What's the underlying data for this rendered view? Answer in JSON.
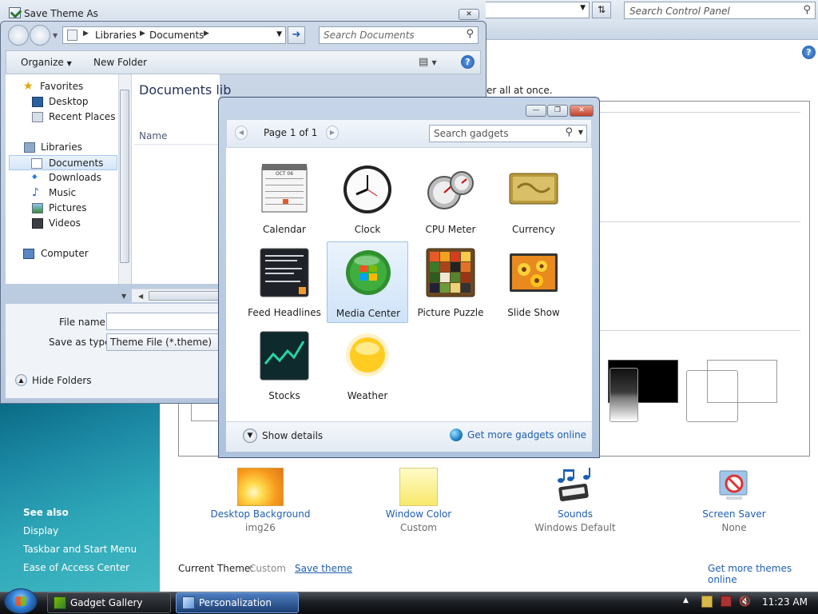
{
  "personalization": {
    "search_placeholder": "Search Control Panel",
    "description_fragment": "er all at once.",
    "sidebar": {
      "see_also": "See also",
      "links": [
        "Display",
        "Taskbar and Start Menu",
        "Ease of Access Center"
      ]
    },
    "settings": [
      {
        "label": "Desktop Background",
        "value": "img26",
        "icon": "desktop-background-thumbnail"
      },
      {
        "label": "Window Color",
        "value": "Custom",
        "icon": "window-color-swatch"
      },
      {
        "label": "Sounds",
        "value": "Windows Default",
        "icon": "sounds-icon"
      },
      {
        "label": "Screen Saver",
        "value": "None",
        "icon": "screen-saver-icon"
      }
    ],
    "current_theme_label": "Current Theme:",
    "current_theme_value": "Custom",
    "save_theme_link": "Save theme",
    "more_themes_link": "Get more themes online",
    "accent_link_color": "#1f5fb4"
  },
  "save_dialog": {
    "title": "Save Theme As",
    "address": {
      "crumbs": [
        "Libraries",
        "Documents"
      ]
    },
    "search_placeholder": "Search Documents",
    "toolbar": {
      "organize": "Organize",
      "new_folder": "New Folder"
    },
    "nav": {
      "favorites": "Favorites",
      "favorite_items": [
        "Desktop",
        "Recent Places"
      ],
      "libraries": "Libraries",
      "library_items": [
        "Documents",
        "Downloads",
        "Music",
        "Pictures",
        "Videos"
      ],
      "computer": "Computer",
      "selected": "Documents"
    },
    "list_title": "Documents lib",
    "column_name": "Name",
    "file_name_label": "File name:",
    "file_name_value": "",
    "save_as_type_label": "Save as type:",
    "save_as_type_value": "Theme File (*.theme)",
    "hide_folders": "Hide Folders"
  },
  "gadget_gallery": {
    "page_label": "Page 1 of 1",
    "search_placeholder": "Search gadgets",
    "gadgets": [
      {
        "name": "Calendar",
        "icon": "calendar-icon",
        "calendar_month": "OCT 06"
      },
      {
        "name": "Clock",
        "icon": "clock-icon"
      },
      {
        "name": "CPU Meter",
        "icon": "cpu-meter-icon"
      },
      {
        "name": "Currency",
        "icon": "currency-icon"
      },
      {
        "name": "Feed Headlines",
        "icon": "feed-headlines-icon"
      },
      {
        "name": "Media Center",
        "icon": "media-center-icon",
        "selected": true
      },
      {
        "name": "Picture Puzzle",
        "icon": "picture-puzzle-icon"
      },
      {
        "name": "Slide Show",
        "icon": "slide-show-icon"
      },
      {
        "name": "Stocks",
        "icon": "stocks-icon"
      },
      {
        "name": "Weather",
        "icon": "weather-icon"
      }
    ],
    "show_details": "Show details",
    "more_gadgets_link": "Get more gadgets online"
  },
  "taskbar": {
    "tasks": [
      {
        "label": "Gadget Gallery",
        "active": false
      },
      {
        "label": "Personalization",
        "active": true
      }
    ],
    "clock": "11:23 AM"
  }
}
